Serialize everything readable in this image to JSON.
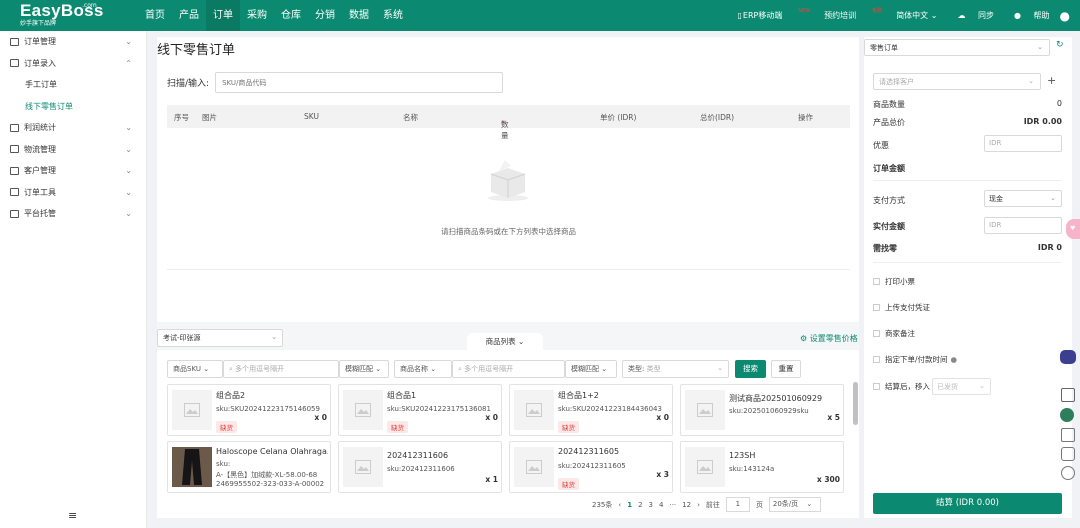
{
  "brand": {
    "name": "EasyBoss",
    "com": ".com",
    "tagline": "妙手旗下品牌"
  },
  "nav": [
    "首页",
    "产品",
    "订单",
    "采购",
    "仓库",
    "分销",
    "数据",
    "系统"
  ],
  "nav_active": "订单",
  "topright": {
    "erp": "ERP移动端",
    "erp_badge": "NEW",
    "train": "预约培训",
    "train_badge": "免费",
    "lang": "简体中文",
    "sync": "同步",
    "help": "帮助"
  },
  "sidebar": {
    "items": [
      {
        "label": "订单管理",
        "chev": "⌄"
      },
      {
        "label": "订单录入",
        "chev": "⌃"
      },
      {
        "label": "手工订单"
      },
      {
        "label": "线下零售订单"
      },
      {
        "label": "利润统计",
        "chev": "⌄"
      },
      {
        "label": "物流管理",
        "chev": "⌄"
      },
      {
        "label": "客户管理",
        "chev": "⌄"
      },
      {
        "label": "订单工具",
        "chev": "⌄"
      },
      {
        "label": "平台托管",
        "chev": "⌄"
      }
    ],
    "footer_icon": "≡"
  },
  "page": {
    "title": "线下零售订单",
    "scan_label": "扫描/输入:",
    "scan_placeholder": "SKU/商品代码"
  },
  "table": {
    "headers": [
      "序号",
      "图片",
      "SKU",
      "名称",
      "数量",
      "单价 (IDR)",
      "总价(IDR)",
      "操作"
    ],
    "required_mark": "*",
    "empty": "请扫描商品条码或在下方列表中选择商品"
  },
  "store_select": "考试-印张源",
  "product_tab": "商品列表",
  "settings_link": "设置零售价格",
  "filters": {
    "f1": "商品SKU",
    "f1_ph": "多个用逗号隔开",
    "f2": "模糊匹配",
    "f3": "商品名称",
    "f3_ph": "多个用逗号隔开",
    "f4": "模糊匹配",
    "f5_label": "类型:",
    "f5_ph": "类型",
    "search": "搜索",
    "reset": "重置"
  },
  "products": [
    {
      "name": "组合品2",
      "sku": "sku:SKU20241223175146059",
      "qty": "x 0",
      "tag": "缺货"
    },
    {
      "name": "组合品1",
      "sku": "sku:SKU20241223175136081",
      "qty": "x 0",
      "tag": "缺货"
    },
    {
      "name": "组合品1+2",
      "sku": "sku:SKU20241223184436043",
      "qty": "x 0",
      "tag": "缺货"
    },
    {
      "name": "测试商品202501060929",
      "sku": "sku:202501060929sku",
      "qty": "x 5",
      "tag": ""
    },
    {
      "name": "Haloscope Celana Olahraga...",
      "sku": "sku:",
      "sku2": "A-【黑色】加绒款-XL-58.00-68",
      "sku3": "2469955502-323-033-A-00002",
      "qty": "",
      "tag": ""
    },
    {
      "name": "202412311606",
      "sku": "sku:202412311606",
      "qty": "x 1",
      "tag": ""
    },
    {
      "name": "202412311605",
      "sku": "sku:202412311605",
      "qty": "x 3",
      "tag": "缺货"
    },
    {
      "name": "123SH",
      "sku": "sku:143124a",
      "qty": "x 300",
      "tag": ""
    }
  ],
  "pager": {
    "total": "235条",
    "pages": [
      "1",
      "2",
      "3",
      "4",
      "···",
      "12"
    ],
    "goto": "前往",
    "page_input": "1",
    "page_unit": "页",
    "size": "20条/页"
  },
  "right": {
    "order_type": "零售订单",
    "customer_ph": "请选择客户",
    "qty_label": "商品数量",
    "qty_val": "0",
    "total_label": "产品总价",
    "total_val": "IDR 0.00",
    "discount_label": "优惠",
    "discount_ph": "IDR",
    "amount_label": "订单金额",
    "pay_label": "支付方式",
    "pay_val": "现金",
    "paid_label": "实付金额",
    "paid_ph": "IDR",
    "change_label": "需找零",
    "change_val": "IDR 0",
    "checks": [
      "打印小票",
      "上传支付凭证",
      "商家备注",
      "指定下单/付款时间"
    ],
    "move_label": "结算后，移入",
    "move_val": "已发货",
    "settle": "结算 (IDR 0.00)"
  },
  "colors": {
    "primary": "#0b8a71",
    "danger": "#e53935"
  }
}
